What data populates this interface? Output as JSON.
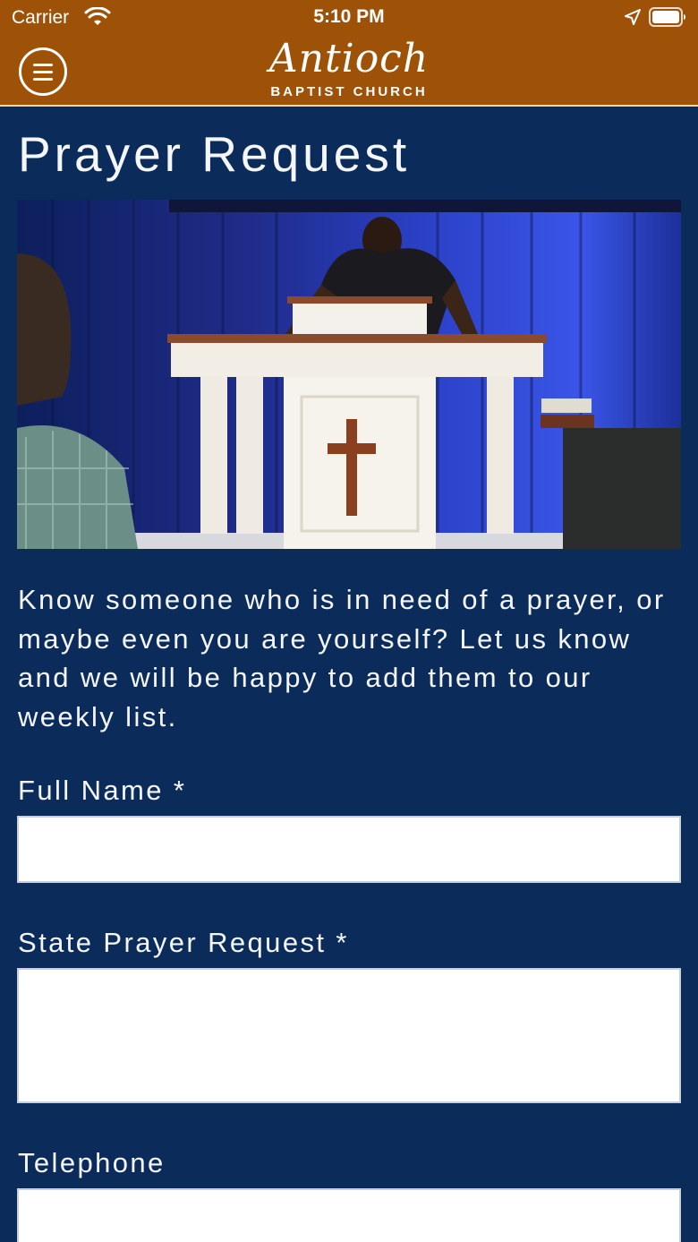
{
  "status_bar": {
    "carrier": "Carrier",
    "time": "5:10 PM"
  },
  "header": {
    "logo_script": "Antioch",
    "logo_subtitle": "BAPTIST CHURCH"
  },
  "page": {
    "title": "Prayer Request",
    "intro": "Know someone who is in need of a prayer, or maybe even you are yourself? Let us know and we will be happy to add them to our weekly list."
  },
  "form": {
    "full_name": {
      "label": "Full Name *",
      "value": ""
    },
    "prayer_request": {
      "label": "State Prayer Request *",
      "value": ""
    },
    "telephone": {
      "label": "Telephone",
      "value": ""
    }
  },
  "colors": {
    "header_bg": "#9e5208",
    "page_bg": "#0b2c5a",
    "field_bg": "#ffffff"
  },
  "icons": [
    "wifi-icon",
    "location-icon",
    "battery-icon",
    "menu-icon"
  ]
}
